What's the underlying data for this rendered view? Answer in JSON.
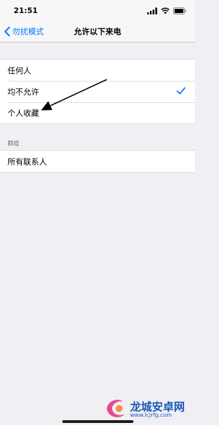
{
  "status_bar": {
    "time": "21:51"
  },
  "nav": {
    "back_label": "勿扰模式",
    "title": "允许以下来电"
  },
  "options": [
    {
      "label": "任何人",
      "selected": false
    },
    {
      "label": "均不允许",
      "selected": true
    },
    {
      "label": "个人收藏",
      "selected": false
    }
  ],
  "groups_section": {
    "header": "群组",
    "items": [
      {
        "label": "所有联系人"
      }
    ]
  },
  "watermark": {
    "name": "龙城安卓网",
    "url": "www.lcjrfg.com"
  },
  "colors": {
    "accent": "#007aff",
    "background": "#efeff4",
    "watermark": "#1c5ab7"
  }
}
